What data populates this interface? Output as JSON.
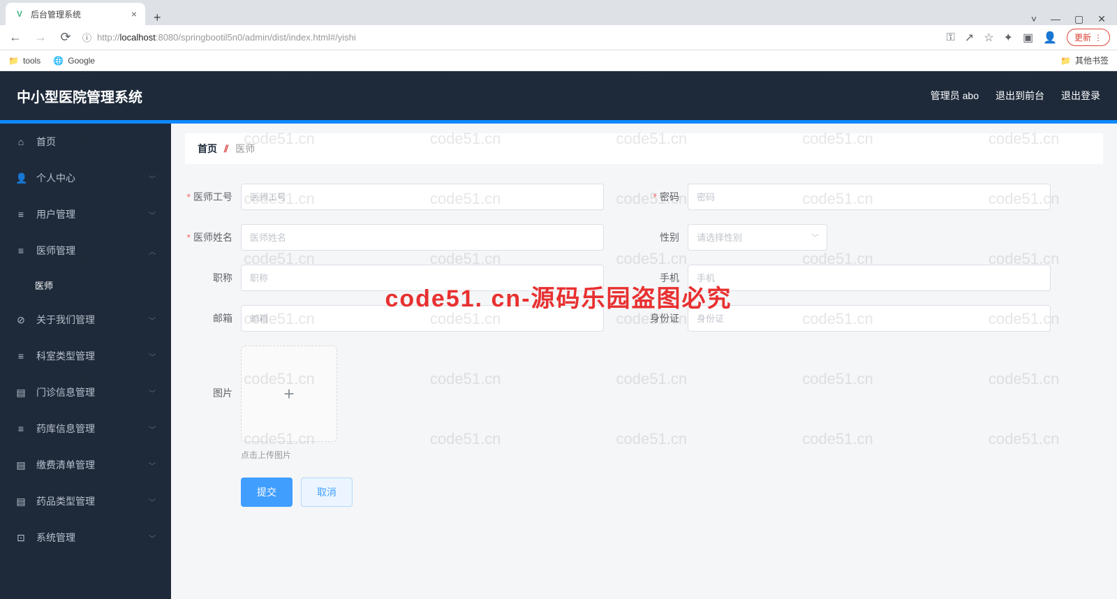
{
  "browser": {
    "tab_title": "后台管理系统",
    "url_prefix": "http://",
    "url_host": "localhost",
    "url_rest": ":8080/springbootil5n0/admin/dist/index.html#/yishi",
    "update_label": "更新",
    "bookmarks": {
      "tools": "tools",
      "google": "Google",
      "other": "其他书签"
    }
  },
  "header": {
    "title": "中小型医院管理系统",
    "user_label": "管理员 abo",
    "exit_front": "退出到前台",
    "logout": "退出登录"
  },
  "sidebar": {
    "items": [
      {
        "icon": "⌂",
        "label": "首页"
      },
      {
        "icon": "👤",
        "label": "个人中心",
        "expandable": true
      },
      {
        "icon": "≡",
        "label": "用户管理",
        "expandable": true
      },
      {
        "icon": "≡",
        "label": "医师管理",
        "expandable": true,
        "open": true
      },
      {
        "icon": "⊘",
        "label": "关于我们管理",
        "expandable": true
      },
      {
        "icon": "≡",
        "label": "科室类型管理",
        "expandable": true
      },
      {
        "icon": "▤",
        "label": "门诊信息管理",
        "expandable": true
      },
      {
        "icon": "≡",
        "label": "药库信息管理",
        "expandable": true
      },
      {
        "icon": "▤",
        "label": "缴费清单管理",
        "expandable": true
      },
      {
        "icon": "▤",
        "label": "药品类型管理",
        "expandable": true
      },
      {
        "icon": "⊡",
        "label": "系统管理",
        "expandable": true
      }
    ],
    "submenu_doctor": "医师"
  },
  "breadcrumb": {
    "home": "首页",
    "current": "医师"
  },
  "form": {
    "doctor_id": {
      "label": "医师工号",
      "placeholder": "医师工号"
    },
    "password": {
      "label": "密码",
      "placeholder": "密码"
    },
    "doctor_name": {
      "label": "医师姓名",
      "placeholder": "医师姓名"
    },
    "gender": {
      "label": "性别",
      "placeholder": "请选择性别"
    },
    "title": {
      "label": "职称",
      "placeholder": "职称"
    },
    "phone": {
      "label": "手机",
      "placeholder": "手机"
    },
    "email": {
      "label": "邮箱",
      "placeholder": "邮箱"
    },
    "idcard": {
      "label": "身份证",
      "placeholder": "身份证"
    },
    "image": {
      "label": "图片",
      "hint": "点击上传图片"
    },
    "submit": "提交",
    "cancel": "取消"
  },
  "watermark": "code51.cn",
  "overlay": "code51. cn-源码乐园盗图必究"
}
